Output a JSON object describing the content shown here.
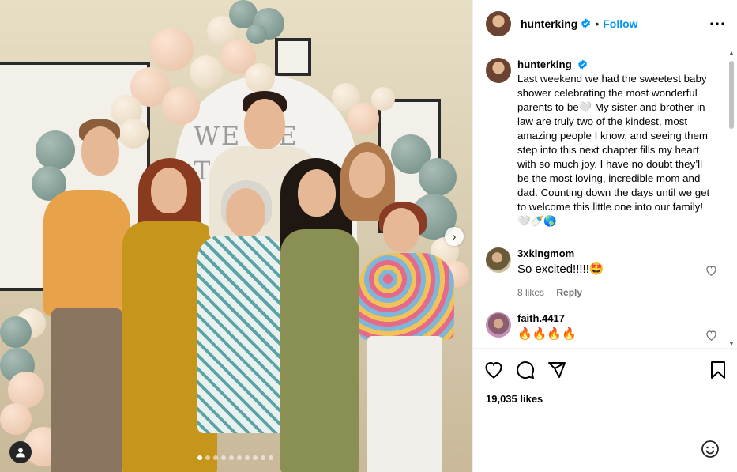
{
  "post": {
    "username": "hunterking",
    "separator": "•",
    "follow_label": "Follow",
    "caption": "Last weekend we had the sweetest baby shower celebrating the most wonderful parents to be🤍 My sister and brother-in-law are truly two of the kindest, most amazing people I know, and seeing them step into this next chapter fills my heart with so much joy. I have no doubt they’ll be the most loving, incredible mom and dad. Counting down the days until we get to welcome this little one into our family! 🤍🍼🌎",
    "likes": "19,035 likes",
    "carousel": {
      "slide_count": 10,
      "active_index": 0
    },
    "decor_text": "WE WE\nTO TH"
  },
  "comments": [
    {
      "username": "3xkingmom",
      "text": "So excited!!!!!🤩",
      "likes": "8 likes",
      "reply_label": "Reply"
    },
    {
      "username": "faith.4417",
      "text": "🔥🔥🔥🔥"
    }
  ],
  "icons": {
    "verified": "verified-badge-icon",
    "more": "more-options-icon",
    "like": "heart-icon",
    "comment": "comment-icon",
    "share": "share-icon",
    "save": "bookmark-icon",
    "emoji": "emoji-icon",
    "next": "chevron-right-icon",
    "tag": "user-tag-icon"
  },
  "colors": {
    "accent": "#0095f6",
    "text": "#000000",
    "muted": "#737373"
  }
}
